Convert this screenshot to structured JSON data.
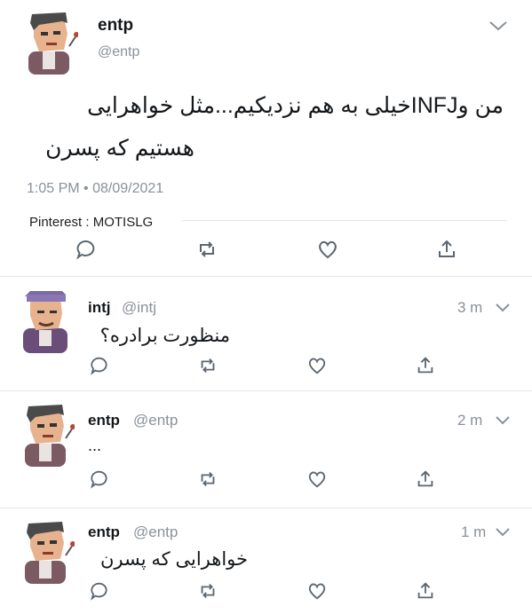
{
  "main_tweet": {
    "display_name": "entp",
    "handle": "@entp",
    "text_line1": "من وINFJخیلی به هم نزدیکیم...مثل خواهرایی",
    "text_line2": "هستیم که پسرن",
    "timestamp": "1:05 PM • 08/09/2021",
    "watermark": "Pinterest : MOTISLG"
  },
  "replies": [
    {
      "display_name": "intj",
      "handle": "@intj",
      "time": "3 m",
      "text": "منظورت برادره؟"
    },
    {
      "display_name": "entp",
      "handle": "@entp",
      "time": "2 m",
      "text": "..."
    },
    {
      "display_name": "entp",
      "handle": "@entp",
      "time": "1 m",
      "text": "خواهرایی که پسرن"
    }
  ],
  "icons": {
    "reply": "reply-icon",
    "retweet": "retweet-icon",
    "like": "like-icon",
    "share": "share-icon",
    "more": "chevron-down-icon"
  },
  "colors": {
    "text": "#14171a",
    "muted": "#8a9198",
    "divider": "#e3e7ea"
  }
}
